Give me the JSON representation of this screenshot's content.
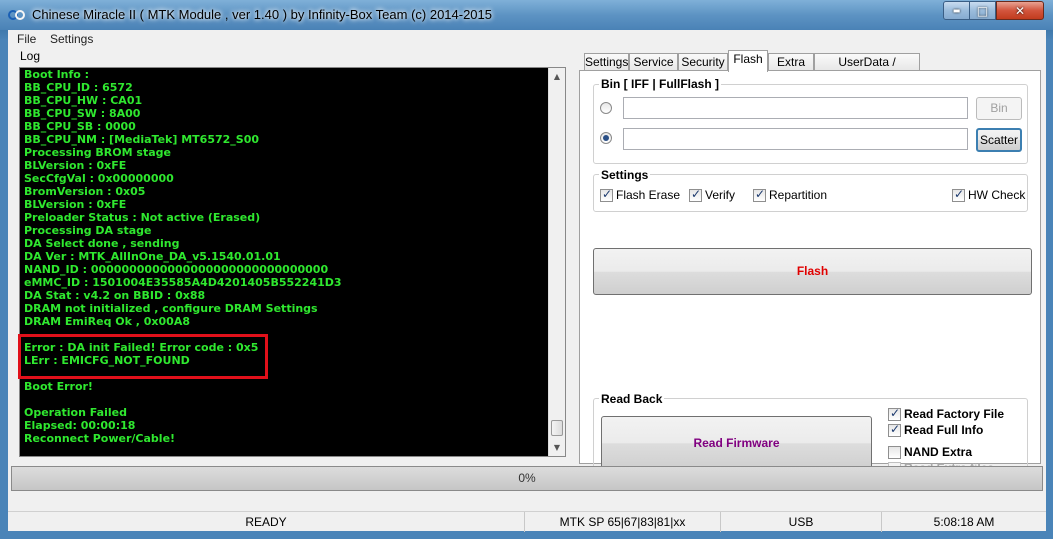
{
  "window": {
    "title": "Chinese Miracle II ( MTK Module , ver 1.40 ) by Infinity-Box Team (c) 2014-2015",
    "controls": {
      "minimize": "▬",
      "maximize": "□",
      "close": "✕"
    }
  },
  "menu": {
    "file": "File",
    "settings": "Settings"
  },
  "log": {
    "label": "Log",
    "lines": [
      "Boot Info :",
      "BB_CPU_ID : 6572",
      "BB_CPU_HW : CA01",
      "BB_CPU_SW : 8A00",
      "BB_CPU_SB : 0000",
      "BB_CPU_NM : [MediaTek] MT6572_S00",
      "Processing BROM stage",
      "BLVersion : 0xFE",
      "SecCfgVal : 0x00000000",
      "BromVersion : 0x05",
      "BLVersion : 0xFE",
      "Preloader Status : Not active (Erased)",
      "Processing DA stage",
      "DA Select done , sending",
      "DA Ver : MTK_AllInOne_DA_v5.1540.01.01",
      "NAND_ID : 0000000000000000000000000000000",
      "eMMC_ID : 1501004E35585A4D4201405B552241D3",
      "DA Stat : v4.2 on BBID : 0x88",
      "DRAM not initialized , configure DRAM Settings",
      "DRAM EmiReq Ok , 0x00A8",
      "",
      "Error : DA init Failed! Error code : 0x5",
      "LErr : EMICFG_NOT_FOUND",
      "",
      "Boot Error!",
      "",
      "Operation Failed",
      "Elapsed: 00:00:18",
      "Reconnect Power/Cable!"
    ]
  },
  "tabs": [
    "Settings",
    "Service",
    "Security",
    "Flash",
    "Extra",
    "UserData / Forensic"
  ],
  "active_tab": "Flash",
  "flash": {
    "bin_group_title": "Bin  [ IFF | FullFlash ]",
    "bin_button": "Bin",
    "scatter_button": "Scatter",
    "bin_path": "",
    "scatter_path": "",
    "selected_source": "scatter",
    "settings_title": "Settings",
    "options": [
      {
        "label": "Flash Erase",
        "checked": true
      },
      {
        "label": "Verify",
        "checked": true
      },
      {
        "label": "Repartition",
        "checked": true
      },
      {
        "label": "HW Check",
        "checked": true
      }
    ],
    "flash_button": "Flash",
    "flash_button_color": "#e00000"
  },
  "read_back": {
    "title": "Read Back",
    "read_firmware_button": "Read Firmware",
    "read_firmware_color": "#800080",
    "options": [
      {
        "label": "Read Factory File",
        "checked": true,
        "enabled": true
      },
      {
        "label": "Read Full Info",
        "checked": true,
        "enabled": true
      },
      {
        "label": "NAND Extra",
        "checked": false,
        "enabled": true
      },
      {
        "label": "Read Extra files",
        "checked": false,
        "enabled": false
      }
    ]
  },
  "progress": {
    "text": "0%",
    "value": 0
  },
  "status": {
    "state": "READY",
    "platform": "MTK SP 65|67|83|81|xx",
    "connection": "USB",
    "time": "5:08:18 AM"
  },
  "colors": {
    "log_text": "#2fe82f",
    "highlight": "#e0101a"
  }
}
